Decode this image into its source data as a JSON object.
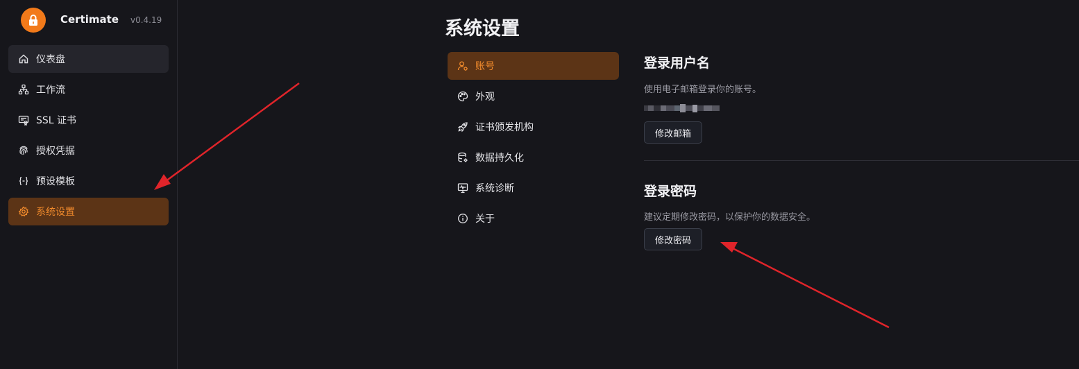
{
  "app": {
    "name": "Certimate",
    "version": "v0.4.19"
  },
  "sidebar": {
    "items": [
      {
        "label": "仪表盘",
        "icon": "home-icon",
        "state": "hover"
      },
      {
        "label": "工作流",
        "icon": "workflow-icon",
        "state": "normal"
      },
      {
        "label": "SSL 证书",
        "icon": "certificate-icon",
        "state": "normal"
      },
      {
        "label": "授权凭据",
        "icon": "fingerprint-icon",
        "state": "normal"
      },
      {
        "label": "预设模板",
        "icon": "braces-icon",
        "state": "normal"
      },
      {
        "label": "系统设置",
        "icon": "gear-icon",
        "state": "active"
      }
    ]
  },
  "main": {
    "title": "系统设置",
    "settings_nav": [
      {
        "label": "账号",
        "icon": "user-icon",
        "state": "active"
      },
      {
        "label": "外观",
        "icon": "palette-icon",
        "state": "normal"
      },
      {
        "label": "证书颁发机构",
        "icon": "rocket-icon",
        "state": "normal"
      },
      {
        "label": "数据持久化",
        "icon": "database-icon",
        "state": "normal"
      },
      {
        "label": "系统诊断",
        "icon": "monitor-icon",
        "state": "normal"
      },
      {
        "label": "关于",
        "icon": "info-icon",
        "state": "normal"
      }
    ],
    "login_username": {
      "title": "登录用户名",
      "description": "使用电子邮箱登录你的账号。",
      "button": "修改邮箱"
    },
    "login_password": {
      "title": "登录密码",
      "description": "建议定期修改密码，以保护你的数据安全。",
      "button": "修改密码"
    }
  },
  "colors": {
    "background": "#16161b",
    "accent": "#f27a1a",
    "active_bg": "#5c3416",
    "active_text": "#f08a2c",
    "annotation_arrow": "#e0242a"
  }
}
